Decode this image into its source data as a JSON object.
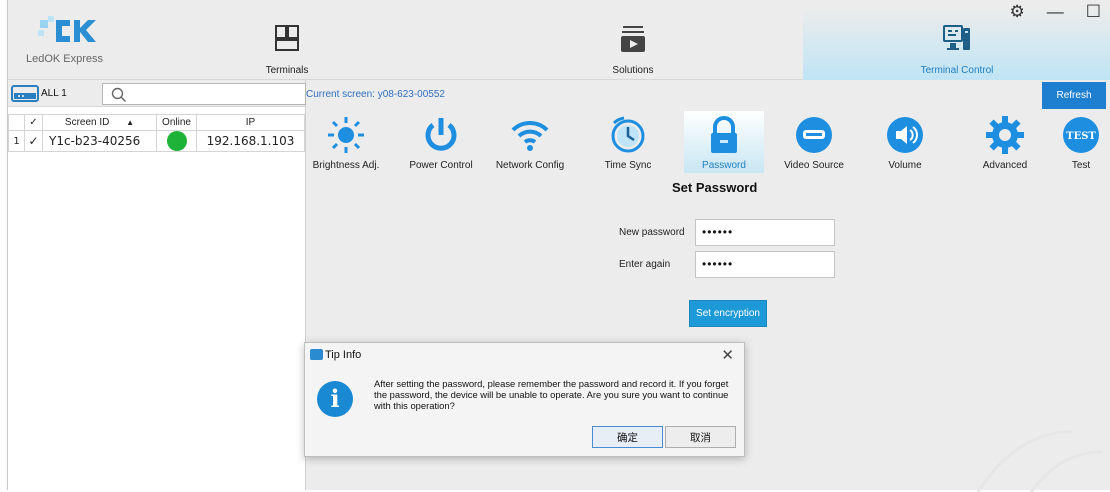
{
  "app": {
    "brand": "LedOK Express"
  },
  "nav": {
    "terminals": "Terminals",
    "solutions": "Solutions",
    "terminal_control": "Terminal Control"
  },
  "toolbar": {
    "all_label": "ALL 1",
    "current_screen": "Current screen: y08-623-00552",
    "refresh": "Refresh"
  },
  "table": {
    "headers": {
      "check": "✓",
      "screen_id": "Screen ID",
      "sort": "▲",
      "online": "Online",
      "ip": "IP"
    },
    "rows": [
      {
        "index": "1",
        "check": "✓",
        "screen_id": "Y1c-b23-40256",
        "online_color": "#1fb238",
        "ip": "192.168.1.103"
      }
    ]
  },
  "functions": [
    {
      "label": "Brightness Adj.",
      "icon": "sun-icon"
    },
    {
      "label": "Power Control",
      "icon": "power-icon"
    },
    {
      "label": "Network Config",
      "icon": "wifi-icon"
    },
    {
      "label": "Time Sync",
      "icon": "clock-icon"
    },
    {
      "label": "Password",
      "icon": "lock-icon"
    },
    {
      "label": "Video Source",
      "icon": "video-source-icon"
    },
    {
      "label": "Volume",
      "icon": "volume-icon"
    },
    {
      "label": "Advanced",
      "icon": "gear-icon"
    },
    {
      "label": "Test",
      "icon": "test-icon",
      "badge": "TEST"
    }
  ],
  "set_password": {
    "title": "Set Password",
    "new_label": "New password",
    "new_value": "••••••",
    "again_label": "Enter again",
    "again_value": "••••••",
    "button": "Set encryption"
  },
  "dialog": {
    "title": "Tip Info",
    "close": "✕",
    "message": "After setting the password, please remember the password and record it. If you forget the password, the device will be unable to operate. Are you sure you want to continue with this operation?",
    "ok": "确定",
    "cancel": "取消"
  },
  "colors": {
    "accent": "#1e7fd0",
    "online": "#1fb238",
    "active_tab": "#bfe4f4"
  }
}
